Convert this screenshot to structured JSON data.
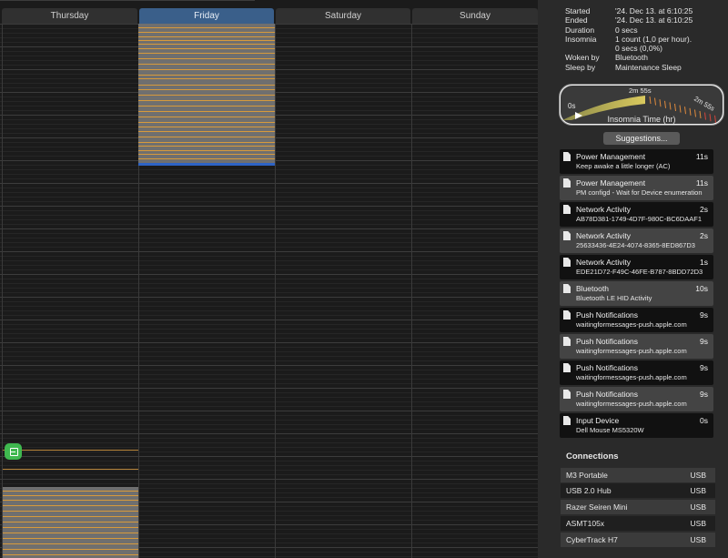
{
  "calendar": {
    "days": [
      {
        "label": "Thursday",
        "selected": false
      },
      {
        "label": "Friday",
        "selected": true
      },
      {
        "label": "Saturday",
        "selected": false
      },
      {
        "label": "Sunday",
        "selected": false
      }
    ]
  },
  "info": {
    "started_label": "Started",
    "started_value": "'24. Dec 13. at 6:10:25",
    "ended_label": "Ended",
    "ended_value": "'24. Dec 13. at 6:10:25",
    "duration_label": "Duration",
    "duration_value": "0 secs",
    "insomnia_label": "Insomnia",
    "insomnia_value": "1 count (1,0 per hour).",
    "insomnia_value2": "0 secs (0,0%)",
    "woken_label": "Woken by",
    "woken_value": "Bluetooth",
    "sleep_label": "Sleep by",
    "sleep_value": "Maintenance Sleep"
  },
  "gauge": {
    "label": "Insomnia Time (hr)",
    "min_label": "0s",
    "mid_label": "2m 55s",
    "max_label": "2m 55s"
  },
  "suggestions_button": "Suggestions...",
  "suggestions": [
    {
      "title": "Power Management",
      "duration": "11s",
      "detail": "Keep awake a little longer (AC)"
    },
    {
      "title": "Power Management",
      "duration": "11s",
      "detail": "PM configd - Wait for Device enumeration"
    },
    {
      "title": "Network Activity",
      "duration": "2s",
      "detail": "AB78D381-1749-4D7F-980C-BC6DAAF1"
    },
    {
      "title": "Network Activity",
      "duration": "2s",
      "detail": "25633436-4E24-4074-8365-8ED867D3"
    },
    {
      "title": "Network Activity",
      "duration": "1s",
      "detail": "EDE21D72-F49C-46FE-B787-8BDD72D3"
    },
    {
      "title": "Bluetooth",
      "duration": "10s",
      "detail": "Bluetooth LE HID Activity"
    },
    {
      "title": "Push Notifications",
      "duration": "9s",
      "detail": "waitingformessages-push.apple.com"
    },
    {
      "title": "Push Notifications",
      "duration": "9s",
      "detail": "waitingformessages-push.apple.com"
    },
    {
      "title": "Push Notifications",
      "duration": "9s",
      "detail": "waitingformessages-push.apple.com"
    },
    {
      "title": "Push Notifications",
      "duration": "9s",
      "detail": "waitingformessages-push.apple.com"
    },
    {
      "title": "Input Device",
      "duration": "0s",
      "detail": "Dell Mouse MS5320W"
    }
  ],
  "connections_title": "Connections",
  "connections": [
    {
      "name": "M3 Portable",
      "type": "USB"
    },
    {
      "name": "USB 2.0 Hub",
      "type": "USB"
    },
    {
      "name": "Razer Seiren Mini",
      "type": "USB"
    },
    {
      "name": "ASMT105x",
      "type": "USB"
    },
    {
      "name": "CyberTrack H7",
      "type": "USB"
    }
  ]
}
